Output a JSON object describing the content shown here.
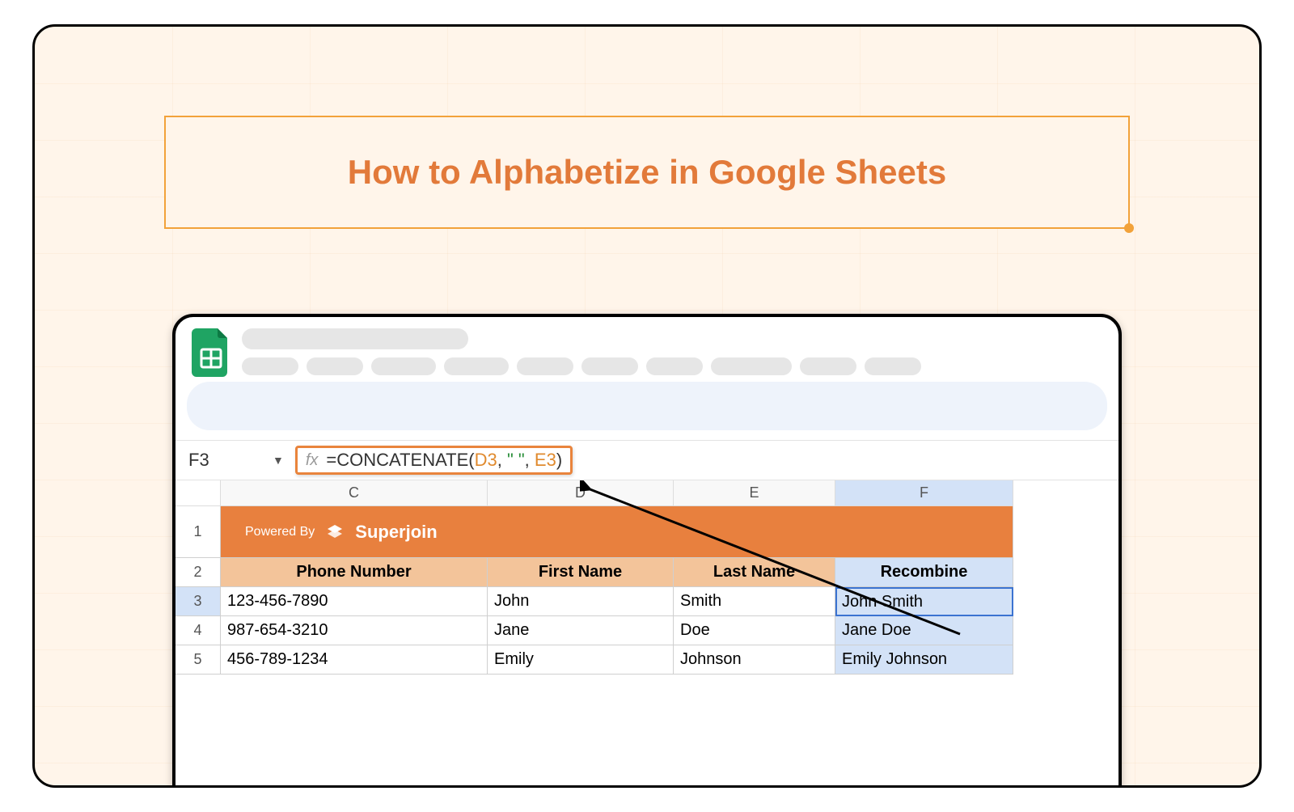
{
  "title": "How to Alphabetize in Google Sheets",
  "cell_ref": "F3",
  "formula_parts": {
    "prefix": "=CONCATENATE(",
    "ref1": "D3",
    "sep1": ", ",
    "str": "\" \"",
    "sep2": ", ",
    "ref2": "E3",
    "suffix": ")"
  },
  "columns": [
    "C",
    "D",
    "E",
    "F"
  ],
  "banner": {
    "powered": "Powered By",
    "brand": "Superjoin"
  },
  "headers": {
    "c": "Phone Number",
    "d": "First Name",
    "e": "Last Name",
    "f": "Recombine"
  },
  "rows": [
    {
      "n": "3",
      "c": "123-456-7890",
      "d": "John",
      "e": "Smith",
      "f": "John Smith"
    },
    {
      "n": "4",
      "c": "987-654-3210",
      "d": "Jane",
      "e": "Doe",
      "f": "Jane Doe"
    },
    {
      "n": "5",
      "c": "456-789-1234",
      "d": "Emily",
      "e": "Johnson",
      "f": "Emily Johnson"
    }
  ],
  "row_labels": {
    "banner": "1",
    "header": "2"
  }
}
